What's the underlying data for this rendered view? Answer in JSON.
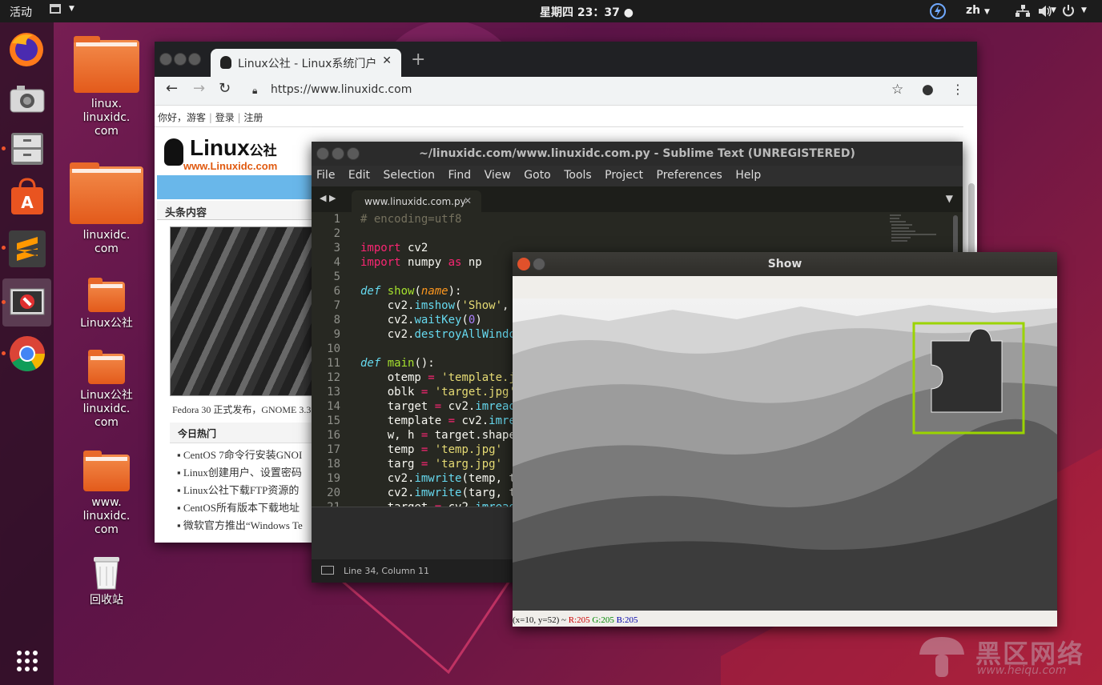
{
  "topbar": {
    "activities": "活动",
    "clock": "星期四 23：37",
    "lang": "zh",
    "icons": [
      "app-menu-icon",
      "lightning-icon",
      "network-icon",
      "volume-icon",
      "power-icon"
    ]
  },
  "dock": {
    "apps": [
      "firefox",
      "screenshot",
      "files",
      "software",
      "sublime-text",
      "show-window",
      "chrome",
      "app-grid"
    ]
  },
  "desktop": {
    "icons": [
      {
        "label": "linux.\nlinuxidc.\ncom"
      },
      {
        "label": "linuxidc.\ncom"
      },
      {
        "label": "Linux公社"
      },
      {
        "label": "Linux公社\nlinuxidc.\ncom"
      },
      {
        "label": "www.\nlinuxidc.\ncom"
      },
      {
        "label": "回收站"
      }
    ]
  },
  "chrome": {
    "tab_title": "Linux公社 - Linux系统门户",
    "url": "https://www.linuxidc.com",
    "site": {
      "greeting": "你好，游客",
      "login": "登录",
      "register": "注册",
      "logo_main": "Linux",
      "logo_cn": "公社",
      "logo_sub": "www.Linuxidc.com",
      "section_head": "头条内容",
      "caption": "Fedora 30 正式发布，GNOME 3.3",
      "hot_head": "今日热门",
      "hot_items": [
        "CentOS 7命令行安装GNOI",
        "Linux创建用户、设置密码",
        "Linux公社下载FTP资源的",
        "CentOS所有版本下载地址",
        "微软官方推出“Windows Te"
      ]
    }
  },
  "sublime": {
    "title": "~/linuxidc.com/www.linuxidc.com.py - Sublime Text (UNREGISTERED)",
    "menu": [
      "File",
      "Edit",
      "Selection",
      "Find",
      "View",
      "Goto",
      "Tools",
      "Project",
      "Preferences",
      "Help"
    ],
    "tab": "www.linuxidc.com.py",
    "status": "Line 34, Column 11",
    "line_numbers": [
      "1",
      "2",
      "3",
      "4",
      "5",
      "6",
      "7",
      "8",
      "9",
      "10",
      "11",
      "12",
      "13",
      "14",
      "15",
      "16",
      "17",
      "18",
      "19",
      "20",
      "21"
    ]
  },
  "show": {
    "title": "Show",
    "status_pos": "(x=10, y=52) ~",
    "status_r": "R:205",
    "status_g": "G:205",
    "status_b": "B:205"
  },
  "watermark": {
    "cn": "黑区网络",
    "url": "www.heiqu.com"
  },
  "colors": {
    "accent_orange": "#e95420",
    "match_box": "#9bd400",
    "sublime_bg": "#272822"
  }
}
